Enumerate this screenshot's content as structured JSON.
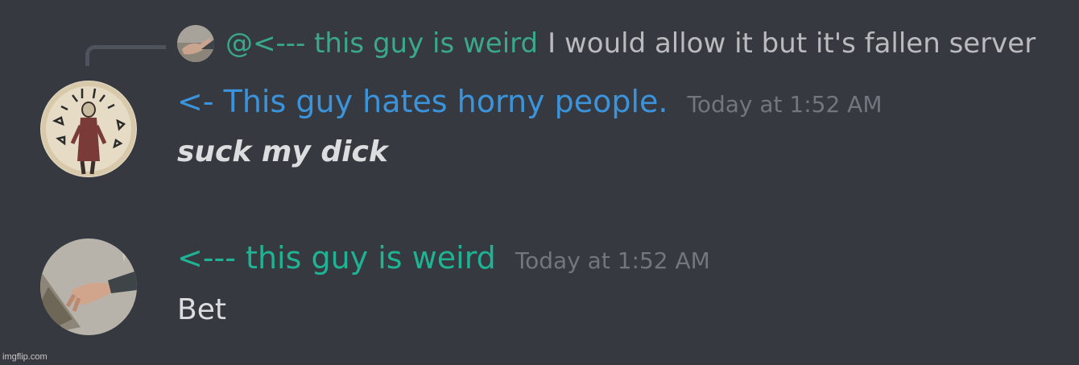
{
  "reply": {
    "mention": "@<--- this guy is weird",
    "text": "I would allow it but it's fallen server",
    "avatar_icon": "hand-photo-avatar-icon"
  },
  "messages": [
    {
      "username": "<- This guy hates horny people.",
      "username_color": "#3b94db",
      "timestamp": "Today at 1:52 AM",
      "content": "suck my dick",
      "avatar_icon": "sketch-figure-avatar-icon"
    },
    {
      "username": "<--- this guy is weird",
      "username_color": "#1fb394",
      "timestamp": "Today at 1:52 AM",
      "content": "Bet",
      "avatar_icon": "hand-photo-avatar-icon"
    }
  ],
  "watermark": "imgflip.com",
  "colors": {
    "background": "#36393f",
    "mention": "#3aa88a",
    "timestamp": "#72767d",
    "text": "#dcddde"
  }
}
